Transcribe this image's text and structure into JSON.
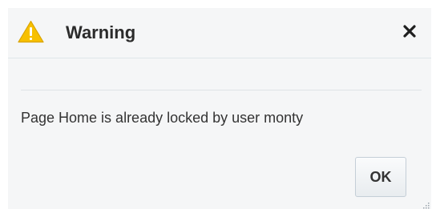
{
  "dialog": {
    "title": "Warning",
    "icon": "warning-icon",
    "close_icon": "close-icon",
    "message": "Page Home is already locked by user monty",
    "ok_label": "OK"
  },
  "colors": {
    "warning_fill": "#f7c000",
    "background": "#f5f6f7",
    "text": "#333333"
  }
}
